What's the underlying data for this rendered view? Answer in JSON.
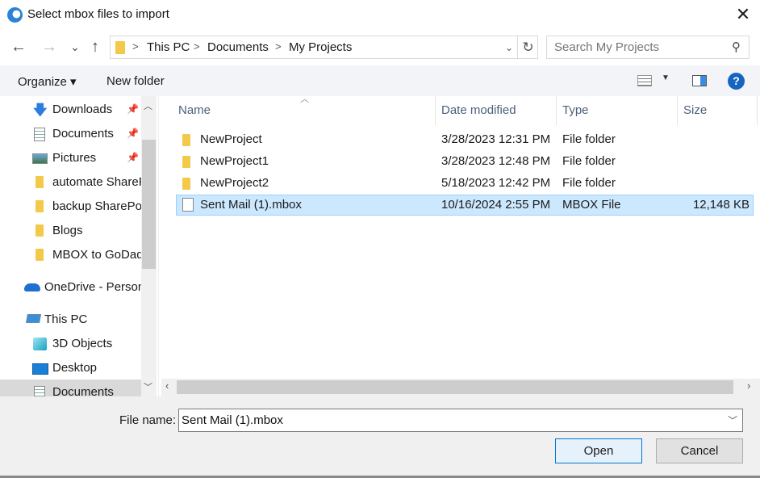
{
  "window": {
    "title": "Select mbox files to import",
    "close_label": "✕"
  },
  "nav": {
    "back": "←",
    "forward": "→",
    "recent": "⌄",
    "up": "↑"
  },
  "address": {
    "crumbs": [
      "This PC",
      "Documents",
      "My Projects"
    ],
    "separator": ">",
    "dropdown": "⌄",
    "refresh": "↻"
  },
  "search": {
    "placeholder": "Search My Projects",
    "icon": "⚲"
  },
  "toolbar": {
    "organize": "Organize ▾",
    "new_folder": "New folder",
    "view_dropdown": "▼",
    "help": "?"
  },
  "sidebar": {
    "items": [
      {
        "label": "Downloads",
        "icon": "download-icon",
        "pinned": true
      },
      {
        "label": "Documents",
        "icon": "documents-icon",
        "pinned": true
      },
      {
        "label": "Pictures",
        "icon": "pictures-icon",
        "pinned": true
      },
      {
        "label": "automate SharePoint",
        "icon": "folder-icon"
      },
      {
        "label": "backup SharePoint",
        "icon": "folder-icon"
      },
      {
        "label": "Blogs",
        "icon": "folder-icon"
      },
      {
        "label": "MBOX to GoDaddy",
        "icon": "folder-icon"
      },
      {
        "label": "OneDrive - Personal",
        "icon": "onedrive-icon"
      },
      {
        "label": "This PC",
        "icon": "pc-icon"
      },
      {
        "label": "3D Objects",
        "icon": "3d-objects-icon"
      },
      {
        "label": "Desktop",
        "icon": "desktop-icon"
      },
      {
        "label": "Documents",
        "icon": "documents-icon"
      }
    ],
    "pin_glyph": "📌"
  },
  "columns": {
    "name": "Name",
    "date": "Date modified",
    "type": "Type",
    "size": "Size"
  },
  "files": [
    {
      "name": "NewProject",
      "date": "3/28/2023 12:31 PM",
      "type": "File folder",
      "size": "",
      "kind": "folder"
    },
    {
      "name": "NewProject1",
      "date": "3/28/2023 12:48 PM",
      "type": "File folder",
      "size": "",
      "kind": "folder"
    },
    {
      "name": "NewProject2",
      "date": "5/18/2023 12:42 PM",
      "type": "File folder",
      "size": "",
      "kind": "folder"
    },
    {
      "name": "Sent Mail (1).mbox",
      "date": "10/16/2024 2:55 PM",
      "type": "MBOX File",
      "size": "12,148 KB",
      "kind": "file",
      "selected": true
    }
  ],
  "footer": {
    "file_name_label": "File name:",
    "file_name_value": "Sent Mail (1).mbox",
    "open": "Open",
    "cancel": "Cancel"
  },
  "colors": {
    "selection": "#cce8ff",
    "accent": "#0078d7",
    "help": "#1565c0"
  }
}
